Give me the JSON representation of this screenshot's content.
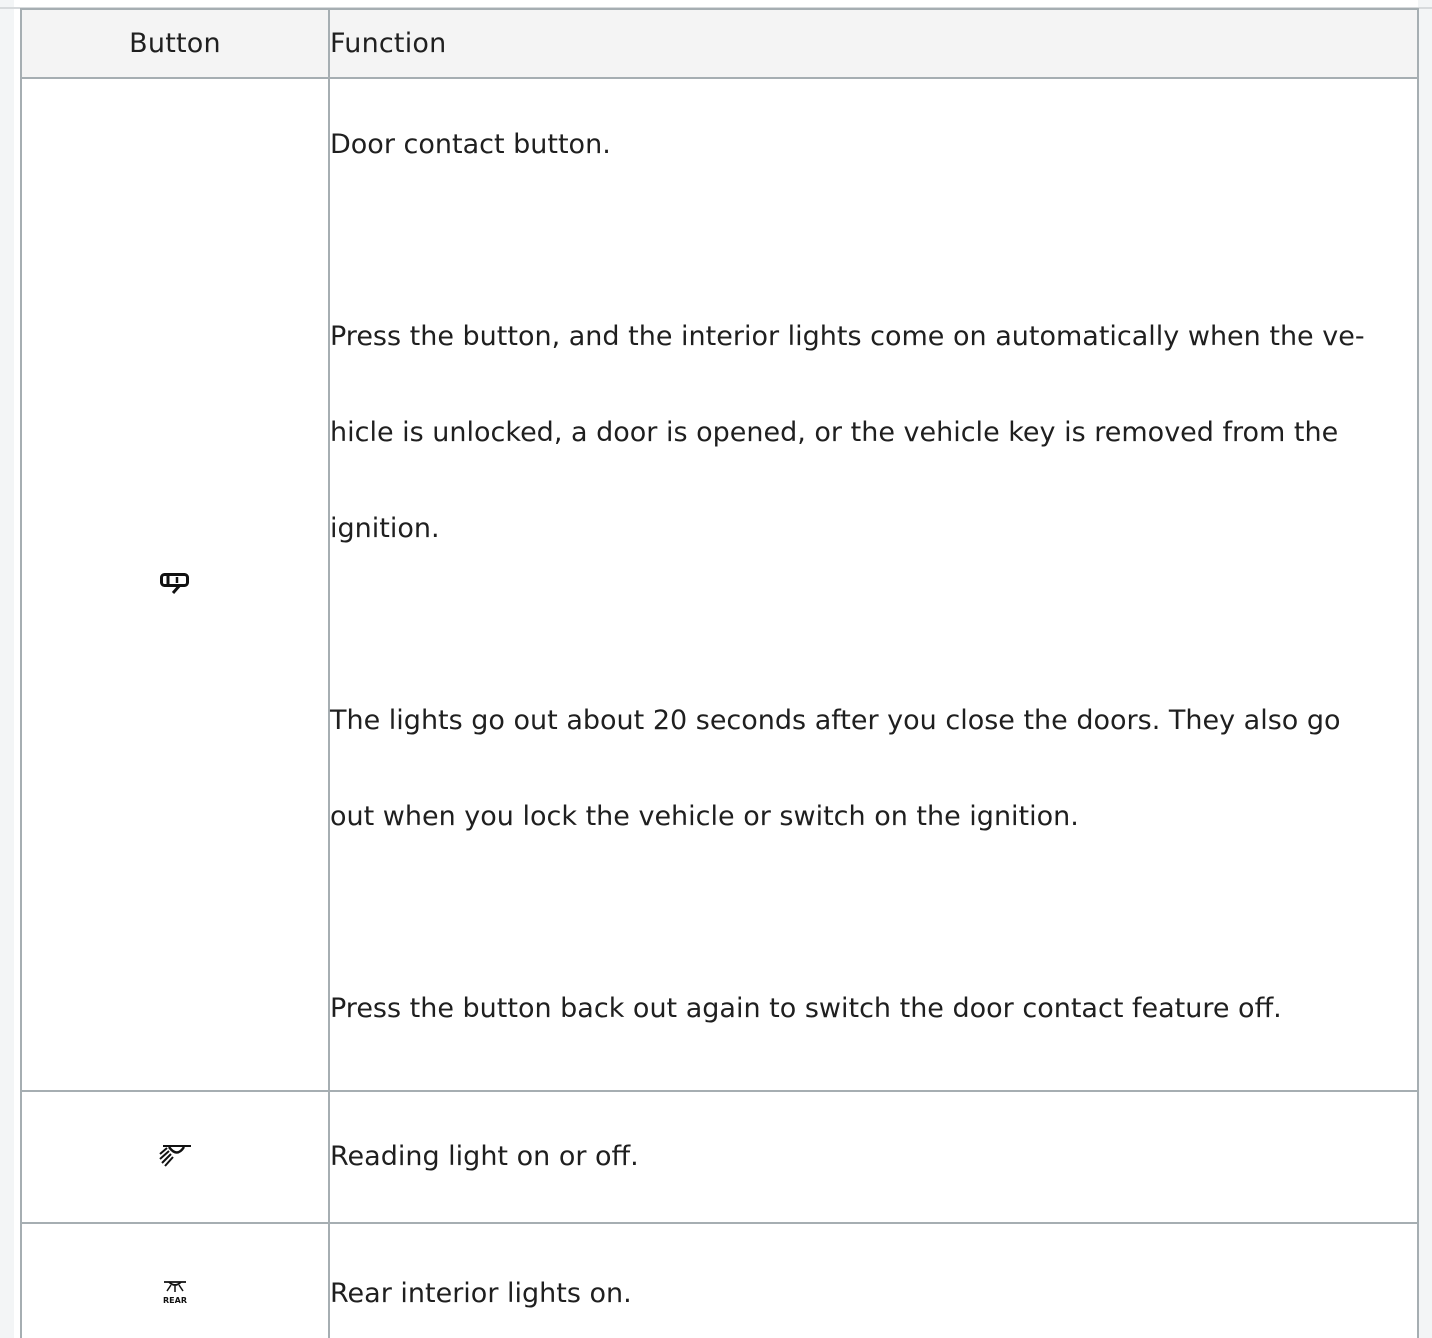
{
  "table": {
    "headers": {
      "button": "Button",
      "function": "Function"
    },
    "rows": [
      {
        "icon": "door-contact-icon",
        "paragraphs": [
          "Door contact button.",
          "Press the button, and the interior lights come on automatically when the ve-",
          "hicle is unlocked, a door is opened, or the vehicle key is removed from the",
          "ignition.",
          "The lights go out about 20 seconds after you close the doors. They also go",
          "out when you lock the vehicle or switch on the ignition.",
          "Press the button back out again to switch the door contact feature off."
        ]
      },
      {
        "icon": "reading-light-icon",
        "text": "Reading light on or off."
      },
      {
        "icon": "rear-interior-light-icon",
        "icon_label": "REAR",
        "text": "Rear interior lights on."
      }
    ]
  },
  "colors": {
    "border": "#a6aeb2",
    "header_background": "#f4f4f4",
    "text": "#1f1f1f"
  }
}
